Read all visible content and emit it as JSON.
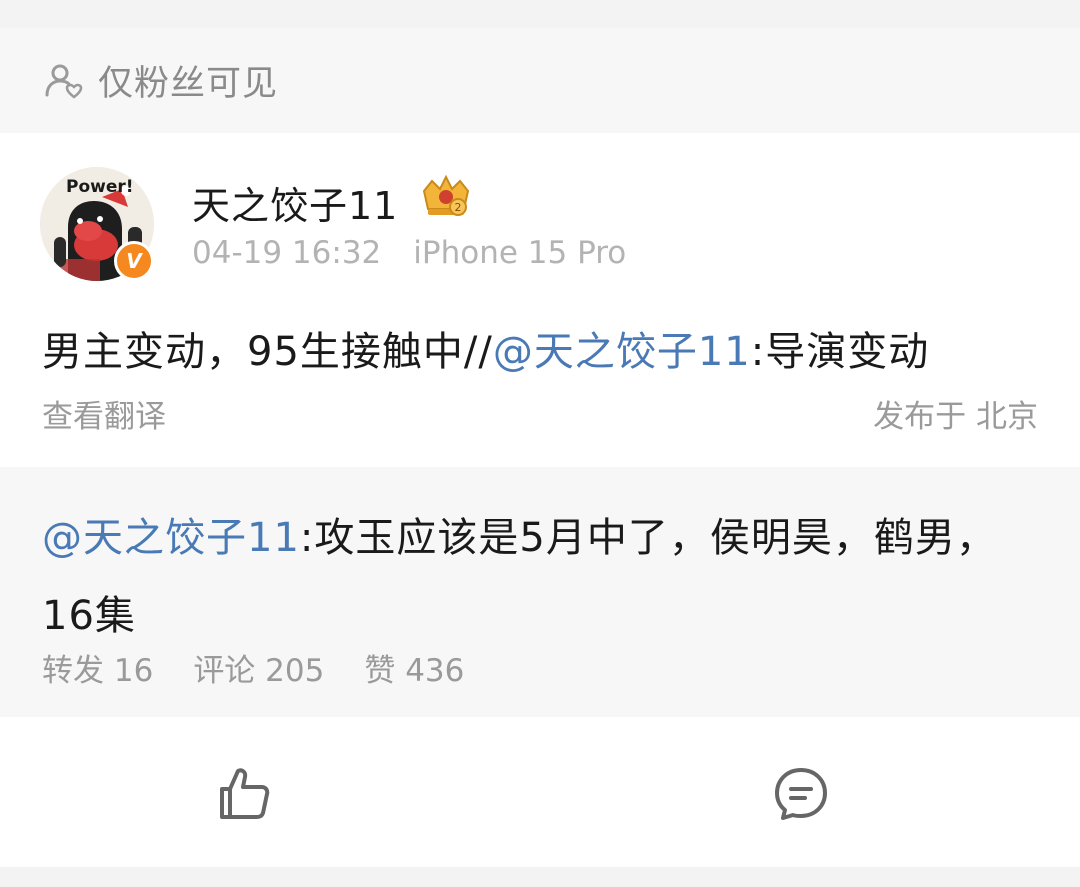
{
  "visibility": {
    "label": "仅粉丝可见",
    "icon": "user-privacy-icon"
  },
  "post": {
    "author": "天之饺子11",
    "avatar_text": "Power!",
    "verified_badge": "V",
    "level_badge_icon": "crown-level-badge-icon",
    "timestamp": "04-19 16:32",
    "device": "iPhone 15 Pro",
    "text_prefix": "男主变动，95生接触中//",
    "mention": "@天之饺子11",
    "text_suffix": ":导演变动",
    "translate_label": "查看翻译",
    "location": "发布于 北京"
  },
  "repost": {
    "mention": "@天之饺子11",
    "text": ":攻玉应该是5月中了，侯明昊，鹤男， 16集",
    "stats": {
      "reposts": "转发 16",
      "comments": "评论 205",
      "likes": "赞 436"
    }
  },
  "actions": {
    "like_icon": "thumbs-up-icon",
    "comment_icon": "comment-icon"
  },
  "colors": {
    "mention": "#4a7ab5",
    "verify": "#f5881f",
    "muted": "#9a9a9a"
  }
}
